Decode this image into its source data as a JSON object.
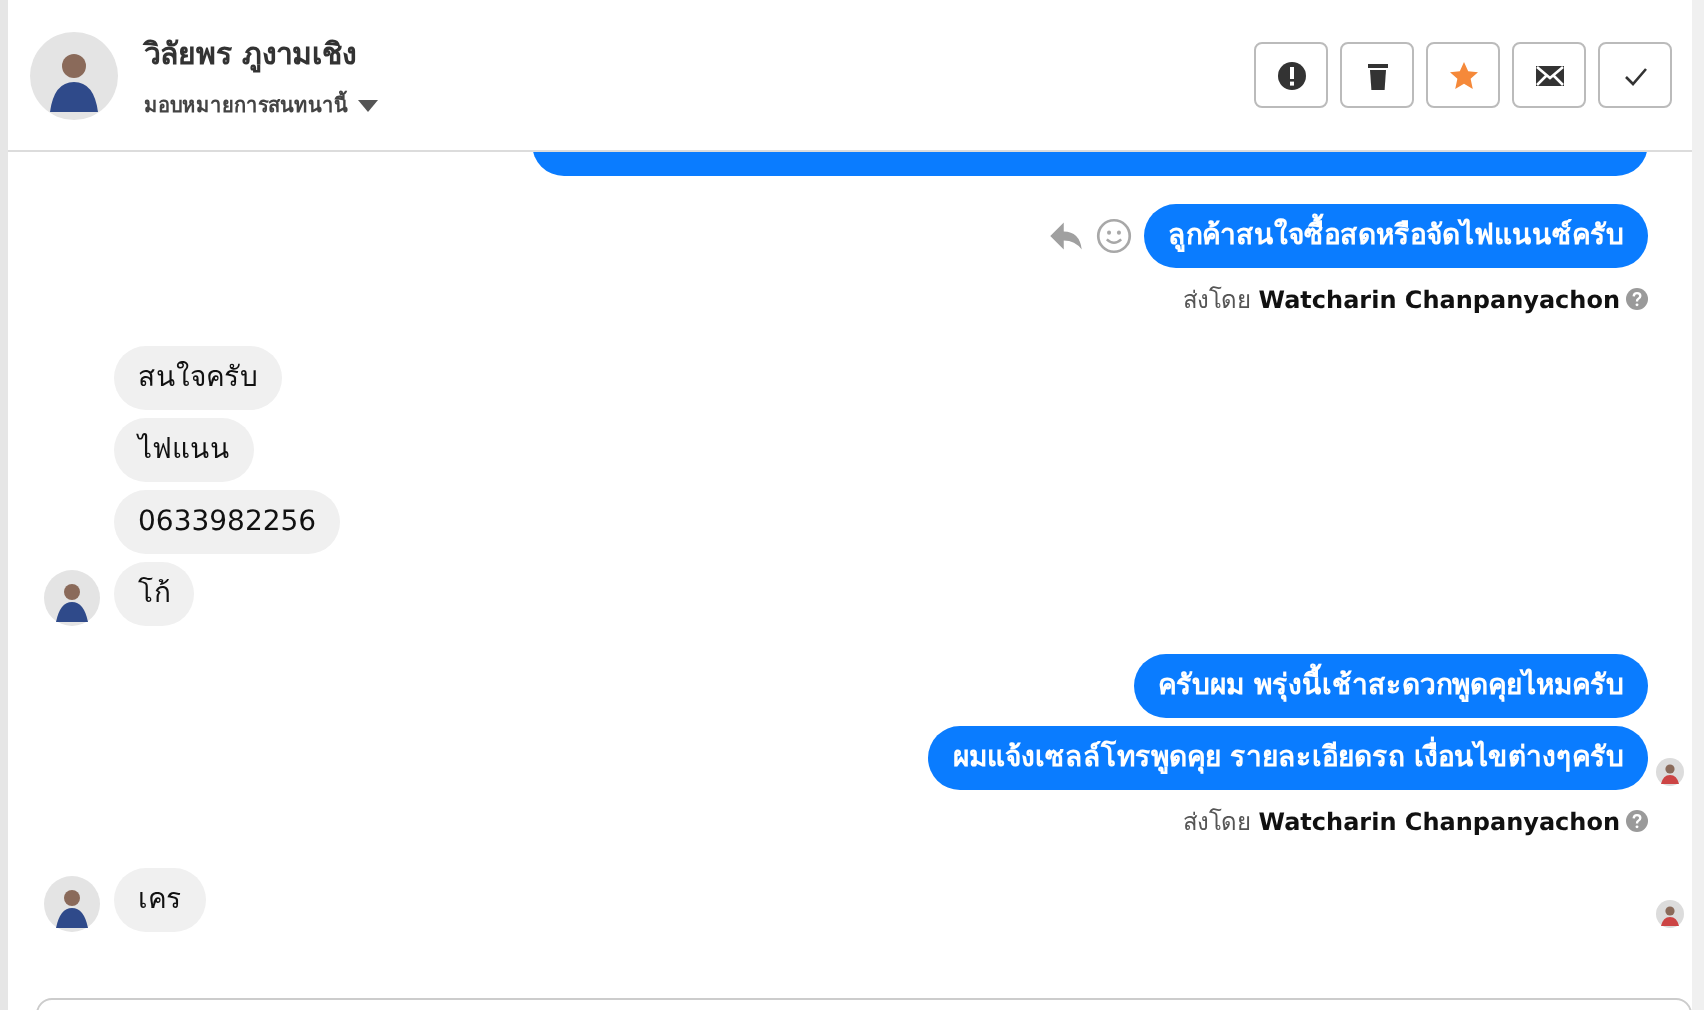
{
  "contact": {
    "name": "วิลัยพร ภูงามเชิง",
    "assign_label": "มอบหมายการสนทนานี้"
  },
  "actions": [
    {
      "kind": "alert",
      "active": false
    },
    {
      "kind": "delete",
      "active": false
    },
    {
      "kind": "star",
      "active": true
    },
    {
      "kind": "mail",
      "active": false
    },
    {
      "kind": "done",
      "active": false
    }
  ],
  "messages": [
    {
      "kind": "clipped"
    },
    {
      "kind": "outgoing",
      "text": "ลูกค้าสนใจซื้อสดหรือจัดไฟแนนซ์ครับ",
      "hover_actions": true
    },
    {
      "kind": "sent_by",
      "prefix": "ส่งโดย",
      "name": "Watcharin Chanpanyachon"
    },
    {
      "kind": "incoming",
      "text": "สนใจครับ"
    },
    {
      "kind": "incoming",
      "text": "ไฟแนน"
    },
    {
      "kind": "incoming",
      "text": "0633982256"
    },
    {
      "kind": "incoming",
      "text": "โก้",
      "avatar": true
    },
    {
      "kind": "outgoing",
      "text": "ครับผม พรุ่งนี้เช้าสะดวกพูดคุยไหมครับ"
    },
    {
      "kind": "outgoing",
      "text": "ผมแจ้งเซลล์โทรพูดคุย รายละเอียดรถ เงื่อนไขต่างๆครับ",
      "seen": true
    },
    {
      "kind": "sent_by",
      "prefix": "ส่งโดย",
      "name": "Watcharin Chanpanyachon"
    },
    {
      "kind": "incoming",
      "text": "เคร",
      "avatar": true,
      "seen": true
    }
  ]
}
